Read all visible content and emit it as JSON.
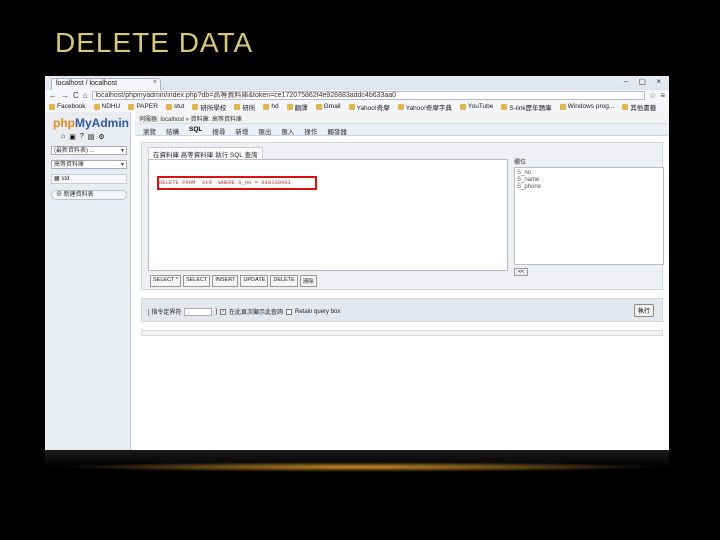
{
  "slide_title": "DELETE DATA",
  "browser": {
    "tab_title": "localhost / localhost",
    "url": "localhost/phpmyadmin/index.php?db=高等資料庫&token=ce172075862f4e926883addc4b633aa0",
    "bookmarks": [
      "Facebook",
      "NDHU",
      "PAPER",
      "stut",
      "研所學校",
      "研所",
      "hd",
      "翻譯",
      "Gmail",
      "Yahoo!奇摩",
      "Yahoo!奇摩字典",
      "YouTube",
      "S-link歷年題庫",
      "Windows prog...",
      "其他書籤"
    ]
  },
  "sidebar": {
    "logo_php": "php",
    "logo_admin": "MyAdmin",
    "recent_select": "(最新資料表) ...",
    "db_select": "高等資料庫",
    "table_item": "std",
    "new_table": "新建資料表"
  },
  "main": {
    "breadcrumb": "伺服器: localhost » 資料庫: 高等資料庫",
    "menu": [
      "瀏覽",
      "結構",
      "SQL",
      "搜尋",
      "新增",
      "匯出",
      "匯入",
      "操作",
      "觸發器"
    ],
    "panel_heading": "在資料庫 高等資料庫 執行 SQL 查詢",
    "sql_text": "DELETE FROM `std` WHERE S_no = 610139001",
    "columns_label": "欄位",
    "columns": [
      "S_no",
      "S_name",
      "S_phone"
    ],
    "back_button": "<<",
    "sql_buttons": [
      "SELECT *",
      "SELECT",
      "INSERT",
      "UPDATE",
      "DELETE",
      "清除"
    ],
    "delimiter_label": "[ 指令定界符",
    "delimiter_value": ";",
    "delimiter_suffix": "]",
    "show_again_label": "在此頁次顯示此查詢",
    "retain_label": "Retain query box",
    "go_button": "執行"
  }
}
